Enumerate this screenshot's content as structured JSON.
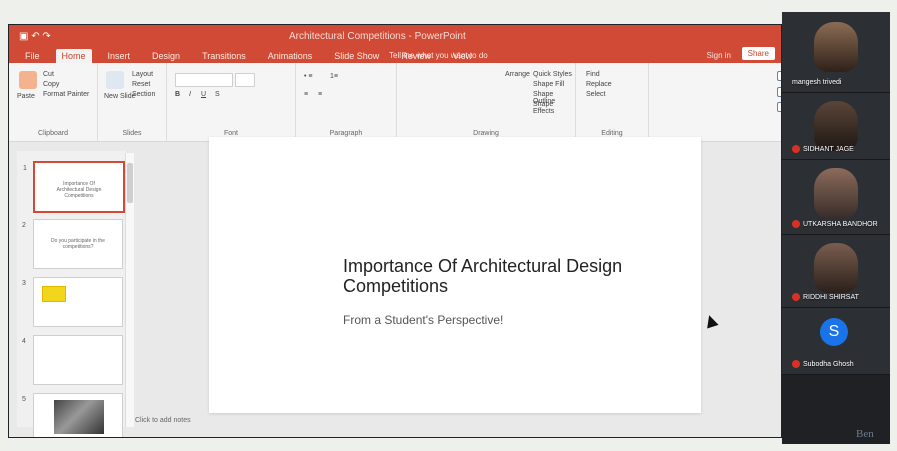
{
  "app": {
    "window_title": "Architectural Competitions - PowerPoint",
    "tabs": [
      "File",
      "Home",
      "Insert",
      "Design",
      "Transitions",
      "Animations",
      "Slide Show",
      "Review",
      "View"
    ],
    "tell_me": "Tell me what you want to do",
    "account": "Sign in",
    "share": "Share"
  },
  "ribbon": {
    "groups": [
      "Clipboard",
      "Slides",
      "Font",
      "Paragraph",
      "Drawing",
      "Editing"
    ],
    "buttons": {
      "paste": "Paste",
      "cut": "Cut",
      "copy": "Copy",
      "format_painter": "Format Painter",
      "new_slide": "New Slide",
      "layout": "Layout",
      "reset": "Reset",
      "section": "Section",
      "find": "Find",
      "replace": "Replace",
      "select": "Select",
      "shape_fill": "Shape Fill",
      "shape_outline": "Shape Outline",
      "shape_effects": "Shape Effects",
      "arrange": "Arrange",
      "quick_styles": "Quick Styles"
    }
  },
  "slides": [
    {
      "number": "1",
      "text": "Importance Of Architectural Design Competitions",
      "active": true
    },
    {
      "number": "2",
      "text": "Do you participate in the competitions?",
      "active": false
    },
    {
      "number": "3",
      "text": "",
      "active": false
    },
    {
      "number": "4",
      "text": "",
      "active": false
    },
    {
      "number": "5",
      "text": "",
      "active": false
    }
  ],
  "slide": {
    "title": "Importance Of Architectural Design Competitions",
    "subtitle": "From a Student's Perspective!"
  },
  "notes": {
    "placeholder": "Click to add notes"
  },
  "participants": [
    {
      "name": "mangesh trivedi",
      "muted": false
    },
    {
      "name": "SIDHANT JAGE",
      "muted": true
    },
    {
      "name": "UTKARSHA BANDHOR",
      "muted": true
    },
    {
      "name": "RIDDHI SHIRSAT",
      "muted": true
    },
    {
      "name": "Subodha Ghosh",
      "muted": true,
      "avatar_letter": "S"
    }
  ],
  "colors": {
    "accent": "#d04a35",
    "panel": "#202124",
    "avatar": "#1a73e8"
  }
}
